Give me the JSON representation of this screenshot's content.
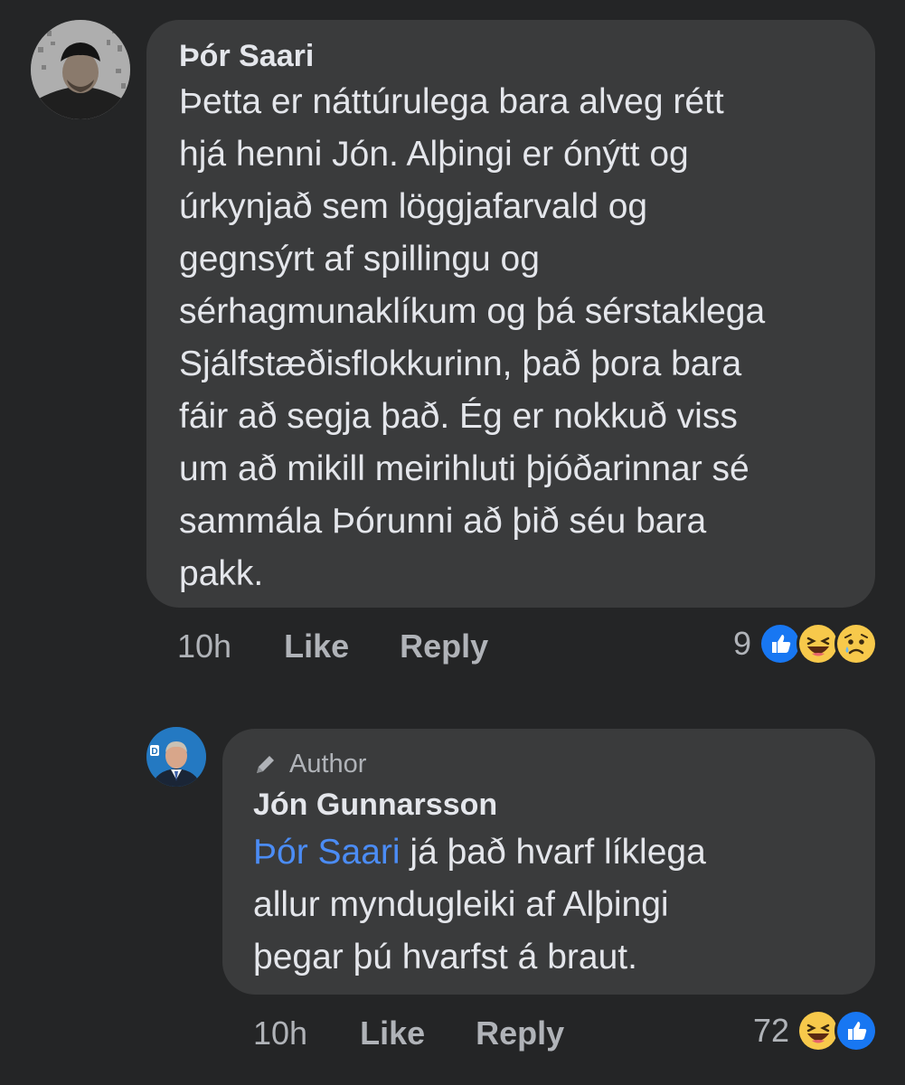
{
  "comments": [
    {
      "author": "Þór Saari",
      "lines": [
        "Þetta er náttúrulega bara alveg rétt",
        "hjá henni Jón. Alþingi er ónýtt og",
        "úrkynjað sem löggjafarvald og",
        "gegnsýrt af spillingu og",
        "sérhagmunaklíkum og þá sérstaklega",
        "Sjálfstæðisflokkurinn, það þora bara",
        "fáir að segja það. Ég er nokkuð viss",
        "um að mikill meirihluti þjóðarinnar sé",
        "sammála Þórunni að þið séu bara",
        "pakk."
      ],
      "time": "10h",
      "like_label": "Like",
      "reply_label": "Reply",
      "reaction_count": "9",
      "reactions": [
        "like",
        "haha",
        "sad"
      ]
    },
    {
      "badge": "Author",
      "author": "Jón Gunnarsson",
      "mention": "Þór Saari",
      "lines": [
        "já það hvarf líklega",
        "allur myndugleiki af Alþingi",
        "þegar þú hvarfst á braut."
      ],
      "time": "10h",
      "like_label": "Like",
      "reply_label": "Reply",
      "reaction_count": "72",
      "reactions": [
        "haha",
        "like"
      ]
    }
  ],
  "colors": {
    "background": "#242526",
    "bubble": "#3a3b3c",
    "text": "#e4e6eb",
    "secondary_text": "#b0b3b8",
    "mention": "#4b8cf5",
    "like_blue": "#1877f2",
    "emoji_yellow": "#f7c94b"
  }
}
